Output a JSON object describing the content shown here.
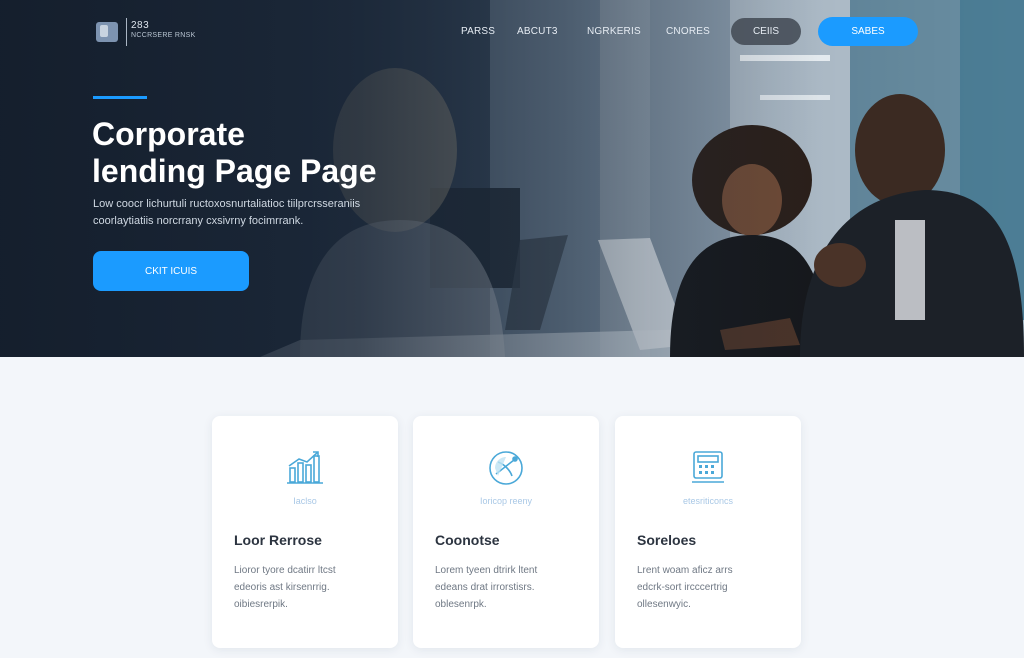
{
  "brand": {
    "logo_top": "283",
    "logo_sub": "NCCRSERE RNSK"
  },
  "nav": {
    "links": [
      "PARSS",
      "ABCUT3",
      "NGRKERIS",
      "CNORES"
    ],
    "pill_dark": "CEIIS",
    "pill_blue": "SABES"
  },
  "hero": {
    "title_line1": "Corporate",
    "title_line2": "lending Page Page",
    "desc_line1": "Low coocr lichurtuli ructoxosnurtaliatioc tiilprcrsseraniis",
    "desc_line2": "coorlaytiatiis norcrrany cxsivrny focimrrank.",
    "cta": "CKIT ICUIS"
  },
  "cards": [
    {
      "icon": "bar-chart-icon",
      "caption": "Iaclso",
      "title": "Loor Rerrose",
      "text": [
        "Lioror tyore dcatirr ltcst",
        "edeoris ast kirsenrrig.",
        "oibiesrerpik."
      ]
    },
    {
      "icon": "satellite-dish-icon",
      "caption": "Ioricop reeny",
      "title": "Coonotse",
      "text": [
        "Lorem tyeen dtrirk ltent",
        "edeans drat irrorstisrs.",
        "oblesenrpk."
      ]
    },
    {
      "icon": "calculator-icon",
      "caption": "etesriticoncs",
      "title": "Soreloes",
      "text": [
        "Lrent woam aficz arrs",
        "edcrk-sort ircccertrig",
        "ollesenwyic."
      ]
    }
  ],
  "colors": {
    "accent": "#1b9bff",
    "hero_dark": "#1c2736",
    "page_bg": "#f3f6fa",
    "card_bg": "#ffffff",
    "title_text": "#2c3440",
    "icon_blue": "#4aa8d8"
  }
}
